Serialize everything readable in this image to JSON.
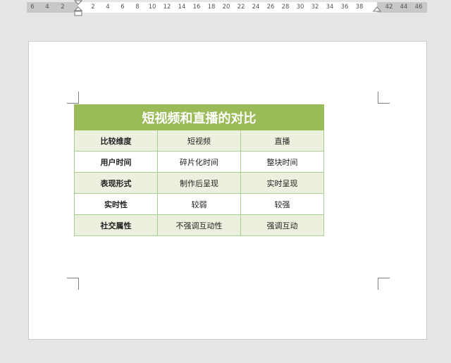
{
  "ruler": {
    "ticks": [
      "6",
      "4",
      "2",
      "2",
      "4",
      "6",
      "8",
      "10",
      "12",
      "14",
      "16",
      "18",
      "20",
      "22",
      "24",
      "26",
      "28",
      "30",
      "32",
      "34",
      "36",
      "38",
      "42",
      "44",
      "46"
    ]
  },
  "table": {
    "title": "短视频和直播的对比",
    "rows": [
      [
        "比较维度",
        "短视频",
        "直播"
      ],
      [
        "用户时间",
        "碎片化时间",
        "整块时间"
      ],
      [
        "表现形式",
        "制作后呈现",
        "实时呈现"
      ],
      [
        "实时性",
        "较弱",
        "较强"
      ],
      [
        "社交属性",
        "不强调互动性",
        "强调互动"
      ]
    ]
  },
  "colors": {
    "title_bg": "#9bbb59",
    "band_bg": "#ebf1de",
    "border": "#a9d08e"
  }
}
